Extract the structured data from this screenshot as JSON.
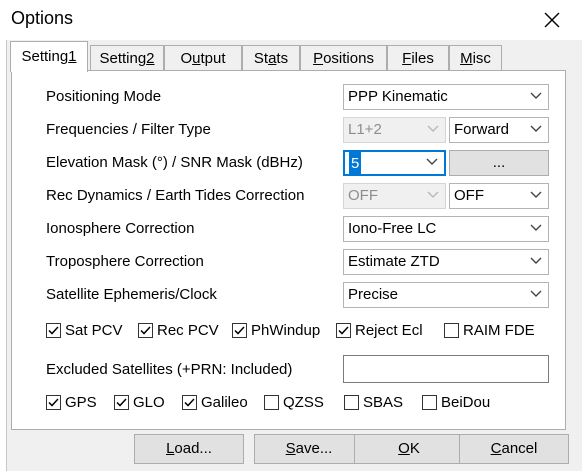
{
  "window": {
    "title": "Options"
  },
  "tabs": [
    {
      "pre": "Setting",
      "key": "1",
      "post": ""
    },
    {
      "pre": "Setting",
      "key": "2",
      "post": ""
    },
    {
      "pre": "O",
      "key": "u",
      "post": "tput"
    },
    {
      "pre": "St",
      "key": "a",
      "post": "ts"
    },
    {
      "pre": "",
      "key": "P",
      "post": "ositions"
    },
    {
      "pre": "",
      "key": "F",
      "post": "iles"
    },
    {
      "pre": "",
      "key": "M",
      "post": "isc"
    }
  ],
  "rows": {
    "positioning_mode": {
      "label": "Positioning Mode",
      "value": "PPP Kinematic"
    },
    "frequencies": {
      "label": "Frequencies / Filter Type",
      "freq": "L1+2",
      "filter": "Forward"
    },
    "elevation": {
      "label": "Elevation Mask (°) / SNR Mask (dBHz)",
      "value": "5",
      "button": "..."
    },
    "dynamics": {
      "label": "Rec Dynamics / Earth Tides Correction",
      "dynamics": "OFF",
      "tides": "OFF"
    },
    "ionosphere": {
      "label": "Ionosphere Correction",
      "value": "Iono-Free LC"
    },
    "troposphere": {
      "label": "Troposphere Correction",
      "value": "Estimate ZTD"
    },
    "ephemeris": {
      "label": "Satellite Ephemeris/Clock",
      "value": "Precise"
    }
  },
  "options": [
    {
      "label": "Sat PCV",
      "checked": true
    },
    {
      "label": "Rec PCV",
      "checked": true
    },
    {
      "label": "PhWindup",
      "checked": true
    },
    {
      "label": "Reject Ecl",
      "checked": true
    },
    {
      "label": "RAIM FDE",
      "checked": false
    }
  ],
  "excluded": {
    "label": "Excluded Satellites (+PRN: Included)",
    "value": ""
  },
  "systems": [
    {
      "label": "GPS",
      "checked": true
    },
    {
      "label": "GLO",
      "checked": true
    },
    {
      "label": "Galileo",
      "checked": true
    },
    {
      "label": "QZSS",
      "checked": false
    },
    {
      "label": "SBAS",
      "checked": false
    },
    {
      "label": "BeiDou",
      "checked": false
    }
  ],
  "buttons": {
    "load": {
      "key": "L",
      "rest": "oad..."
    },
    "save": {
      "key": "S",
      "rest": "ave..."
    },
    "ok": {
      "key": "O",
      "rest": "K"
    },
    "cancel": {
      "key": "C",
      "rest": "ancel"
    }
  }
}
